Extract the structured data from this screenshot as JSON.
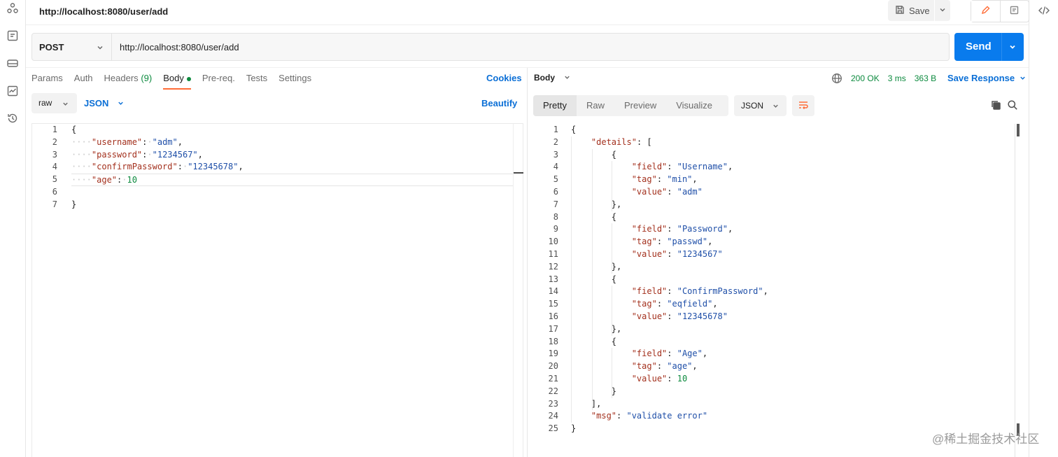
{
  "rail": {
    "left_icons": [
      "collections-icon",
      "apis-icon",
      "environments-icon",
      "monitors-icon",
      "history-icon"
    ],
    "right_icons": [
      "code-icon"
    ]
  },
  "titlebar": {
    "title": "http://localhost:8080/user/add",
    "save_label": "Save"
  },
  "request": {
    "method": "POST",
    "url": "http://localhost:8080/user/add",
    "send_label": "Send"
  },
  "request_tabs": {
    "params": "Params",
    "auth": "Auth",
    "headers": "Headers",
    "headers_count": "(9)",
    "body": "Body",
    "prereq": "Pre-req.",
    "tests": "Tests",
    "settings": "Settings",
    "cookies": "Cookies"
  },
  "body_options": {
    "mode": "raw",
    "language": "JSON",
    "beautify": "Beautify"
  },
  "request_body_line_numbers": [
    "1",
    "2",
    "3",
    "4",
    "5",
    "6",
    "7"
  ],
  "request_body": {
    "open": "{",
    "close": "}",
    "fields": [
      {
        "key": "\"username\"",
        "value": "\"adm\"",
        "kind": "string",
        "comma": ","
      },
      {
        "key": "\"password\"",
        "value": "\"1234567\"",
        "kind": "string",
        "comma": ","
      },
      {
        "key": "\"confirmPassword\"",
        "value": "\"12345678\"",
        "kind": "string",
        "comma": ","
      },
      {
        "key": "\"age\"",
        "value": "10",
        "kind": "number",
        "comma": ""
      }
    ]
  },
  "response": {
    "section_label": "Body",
    "status": "200 OK",
    "time": "3 ms",
    "size": "363 B",
    "save_response": "Save Response",
    "view_tabs": [
      "Pretty",
      "Raw",
      "Preview",
      "Visualize"
    ],
    "format": "JSON"
  },
  "response_line_numbers": [
    "1",
    "2",
    "3",
    "4",
    "5",
    "6",
    "7",
    "8",
    "9",
    "10",
    "11",
    "12",
    "13",
    "14",
    "15",
    "16",
    "17",
    "18",
    "19",
    "20",
    "21",
    "22",
    "23",
    "24",
    "25"
  ],
  "response_body": {
    "details_key": "\"details\"",
    "msg_key": "\"msg\"",
    "msg_value": "\"validate error\"",
    "items": [
      {
        "field": "\"Username\"",
        "tag": "\"min\"",
        "value": "\"adm\"",
        "value_kind": "string"
      },
      {
        "field": "\"Password\"",
        "tag": "\"passwd\"",
        "value": "\"1234567\"",
        "value_kind": "string"
      },
      {
        "field": "\"ConfirmPassword\"",
        "tag": "\"eqfield\"",
        "value": "\"12345678\"",
        "value_kind": "string"
      },
      {
        "field": "\"Age\"",
        "tag": "\"age\"",
        "value": "10",
        "value_kind": "number"
      }
    ],
    "keys": {
      "field": "\"field\"",
      "tag": "\"tag\"",
      "value": "\"value\""
    }
  },
  "watermark": "@稀土掘金技术社区",
  "colors": {
    "accent": "#ff6c37",
    "send": "#097bed",
    "link": "#0b6fd6",
    "success": "#0c8a3e",
    "json_key": "#a3301d",
    "json_string": "#1f4fa8",
    "json_number": "#0c8a3e"
  }
}
